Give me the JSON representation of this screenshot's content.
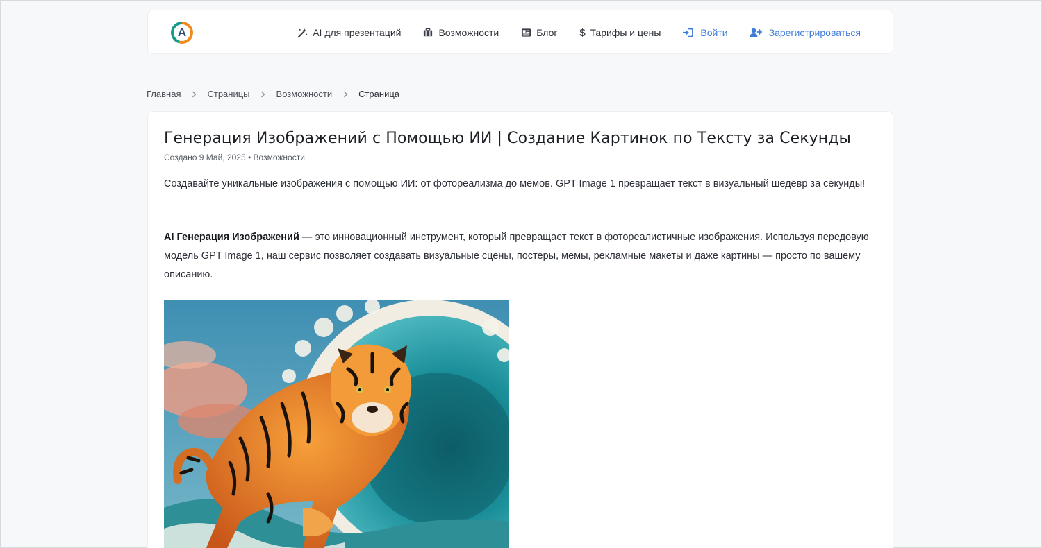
{
  "header": {
    "logo_letter": "A",
    "nav": [
      {
        "label": "AI для презентаций",
        "icon": "magic-wand-icon"
      },
      {
        "label": "Возможности",
        "icon": "briefcase-icon"
      },
      {
        "label": "Блог",
        "icon": "newspaper-icon"
      },
      {
        "label": "Тарифы и цены",
        "icon": "dollar-icon"
      },
      {
        "label": "Войти",
        "icon": "sign-in-icon"
      },
      {
        "label": "Зарегистрироваться",
        "icon": "user-plus-icon"
      }
    ]
  },
  "breadcrumb": [
    "Главная",
    "Страницы",
    "Возможности",
    "Страница"
  ],
  "article": {
    "title": "Генерация Изображений с Помощью ИИ | Создание Картинок по Тексту за Секунды",
    "meta_created": "Создано 9 Май, 2025",
    "meta_separator": "•",
    "meta_category": "Возможности",
    "intro": "Создавайте уникальные изображения с помощью ИИ: от фотореализма до мемов. GPT Image 1 превращает текст в визуальный шедевр за секунды!",
    "para_bold": "AI Генерация Изображений",
    "para_rest": " — это инновационный инструмент, который превращает текст в фотореалистичные изображения. Используя передовую модель GPT Image 1, наш сервис позволяет создавать визуальные сцены, постеры, мемы, рекламные макеты и даже картины — просто по вашему описанию."
  },
  "colors": {
    "accent_blue": "#3d7bd9",
    "background": "#f7f8fa"
  }
}
